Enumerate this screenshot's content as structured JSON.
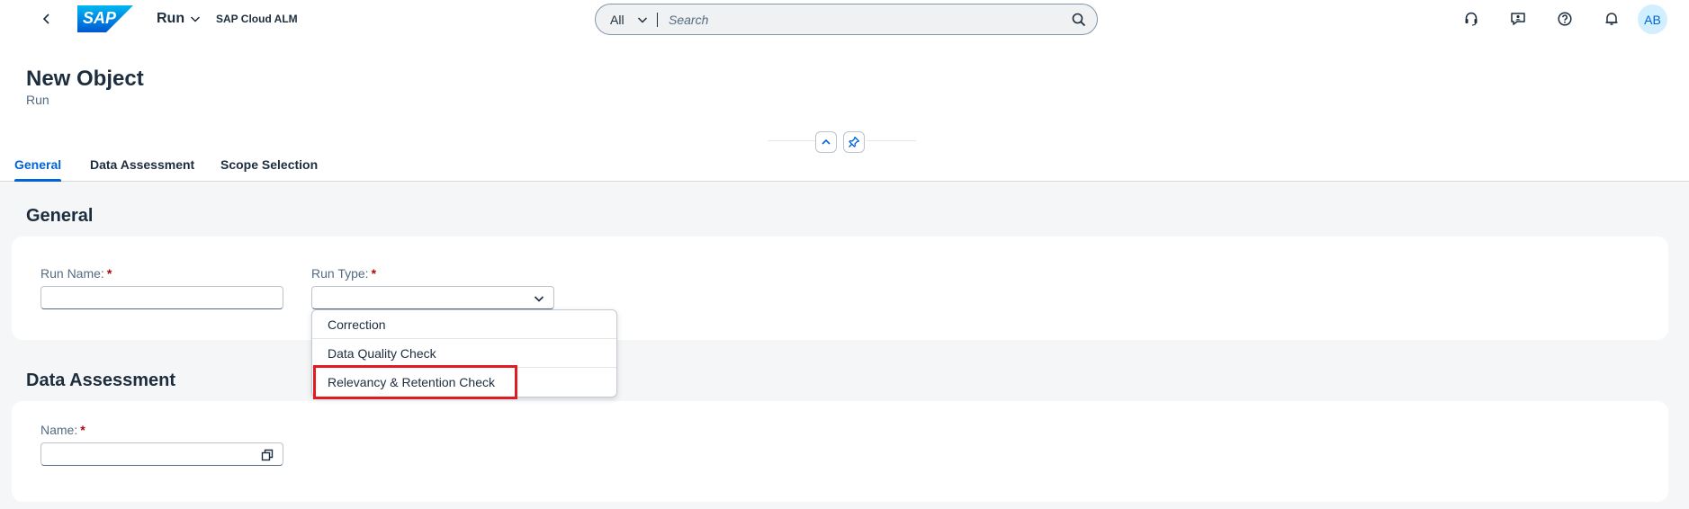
{
  "shell": {
    "app_name": "Run",
    "product_name": "SAP Cloud ALM",
    "logo_text": "SAP",
    "search_scope": "All",
    "search_placeholder": "Search",
    "avatar_initials": "AB",
    "brand_color": "#0070f2"
  },
  "header": {
    "title": "New Object",
    "subtitle": "Run"
  },
  "tabs": [
    {
      "label": "General",
      "active": true
    },
    {
      "label": "Data Assessment",
      "active": false
    },
    {
      "label": "Scope Selection",
      "active": false
    }
  ],
  "general": {
    "section_title": "General",
    "run_name_label": "Run Name:",
    "run_name_value": "",
    "run_type_label": "Run Type:",
    "run_type_value": ""
  },
  "dropdown": {
    "options": [
      "Correction",
      "Data Quality Check",
      "Relevancy & Retention Check"
    ],
    "highlighted": "Relevancy & Retention Check"
  },
  "data_assessment": {
    "section_title": "Data Assessment",
    "name_label": "Name:",
    "name_value": ""
  },
  "required_marker": "*",
  "icons": [
    "back-icon",
    "chevron-down-icon",
    "search-icon",
    "headset-icon",
    "feedback-icon",
    "help-icon",
    "bell-icon",
    "collapse-header-icon",
    "pin-icon",
    "value-help-icon"
  ]
}
